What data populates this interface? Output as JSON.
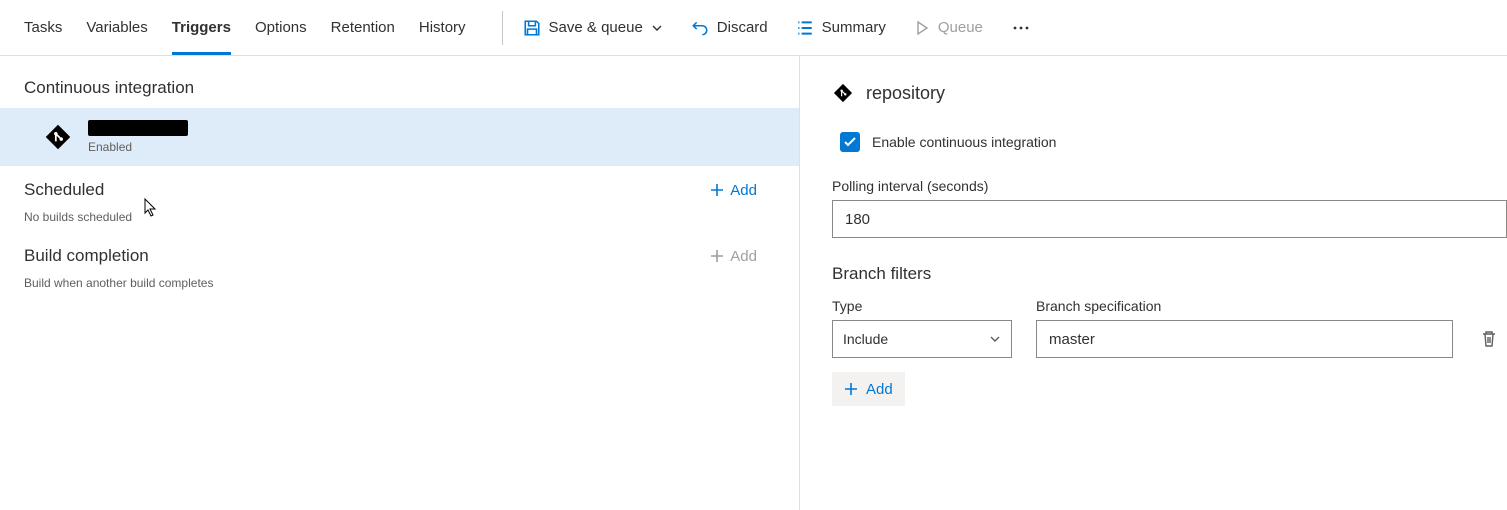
{
  "tabs": {
    "tasks": "Tasks",
    "variables": "Variables",
    "triggers": "Triggers",
    "options": "Options",
    "retention": "Retention",
    "history": "History"
  },
  "toolbar": {
    "save_queue": "Save & queue",
    "discard": "Discard",
    "summary": "Summary",
    "queue": "Queue"
  },
  "left": {
    "ci_title": "Continuous integration",
    "repo_status": "Enabled",
    "scheduled_title": "Scheduled",
    "scheduled_empty": "No builds scheduled",
    "build_completion_title": "Build completion",
    "build_completion_sub": "Build when another build completes",
    "add": "Add"
  },
  "right": {
    "header": "repository",
    "enable_ci_label": "Enable continuous integration",
    "polling_label": "Polling interval (seconds)",
    "polling_value": "180",
    "branch_filters_title": "Branch filters",
    "type_label": "Type",
    "type_value": "Include",
    "branch_spec_label": "Branch specification",
    "branch_spec_value": "master",
    "add": "Add"
  }
}
